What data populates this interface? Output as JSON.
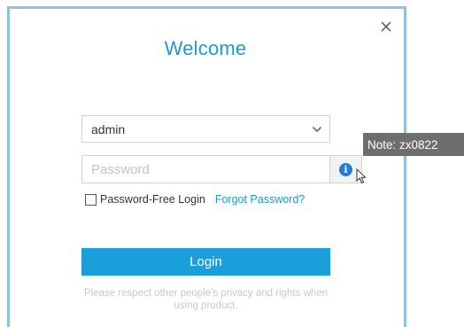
{
  "dialog": {
    "title": "Welcome",
    "close_icon": "close-icon"
  },
  "form": {
    "username": {
      "value": "admin",
      "icon": "chevron-down-icon"
    },
    "password": {
      "value": "",
      "placeholder": "Password"
    },
    "info_button": {
      "icon": "info-icon",
      "glyph": "i"
    },
    "remember": {
      "label": "Password-Free Login",
      "checked": false
    },
    "forgot_password_label": "Forgot Password?",
    "login_label": "Login",
    "privacy_note": "Please respect other people's privacy and rights when using product."
  },
  "tooltip": {
    "text": "Note: zx0822"
  },
  "colors": {
    "accent": "#1a9ad6",
    "button": "#1a9fdb",
    "dialog_border": "#8fc2dd",
    "info_icon": "#1e7fd6",
    "tooltip_bg": "#6e6e6e"
  }
}
